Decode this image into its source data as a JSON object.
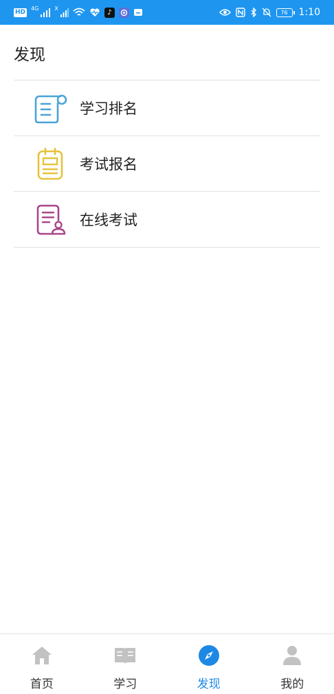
{
  "status_bar": {
    "hd_badge": "HD",
    "net_label_1": "4G",
    "net_label_2": "X",
    "douyin_label": "♪",
    "battery_level": "76",
    "time": "1:10",
    "bg_color": "#1e96f0"
  },
  "page": {
    "title": "发现"
  },
  "list": {
    "items": [
      {
        "label": "学习排名",
        "icon": "scroll-icon",
        "color": "#4aa3d6"
      },
      {
        "label": "考试报名",
        "icon": "notepad-icon",
        "color": "#e6c33a"
      },
      {
        "label": "在线考试",
        "icon": "exam-paper-icon",
        "color": "#a8468a"
      }
    ]
  },
  "tabbar": {
    "tabs": [
      {
        "label": "首页",
        "icon": "home-icon",
        "active": false
      },
      {
        "label": "学习",
        "icon": "book-icon",
        "active": false
      },
      {
        "label": "发现",
        "icon": "compass-icon",
        "active": true
      },
      {
        "label": "我的",
        "icon": "user-icon",
        "active": false
      }
    ],
    "active_color": "#1e88e5",
    "inactive_color": "#333333",
    "inactive_icon_color": "#c2c2c2"
  }
}
